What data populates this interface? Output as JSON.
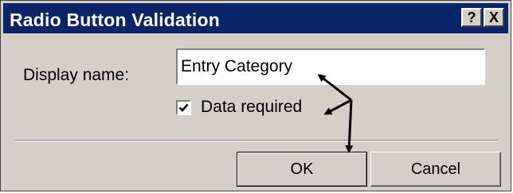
{
  "window": {
    "title": "Radio Button Validation",
    "help_label": "?",
    "close_label": "X",
    "titlebar_color": "#0a246a",
    "face_color": "#d4d0c8"
  },
  "form": {
    "display_name_label": "Display name:",
    "display_name_value": "Entry Category",
    "data_required_label": "Data required",
    "data_required_checked": true
  },
  "buttons": {
    "ok_label": "OK",
    "cancel_label": "Cancel"
  },
  "annotation": {
    "color": "#000000"
  }
}
